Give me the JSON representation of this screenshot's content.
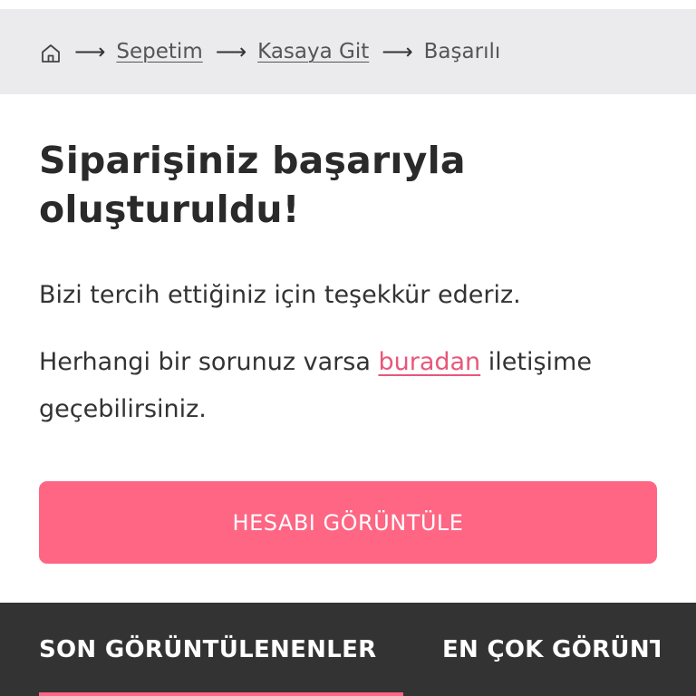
{
  "breadcrumb": {
    "home_icon": "home-icon",
    "separator": "⟶",
    "items": [
      {
        "label": "Sepetim",
        "link": true
      },
      {
        "label": "Kasaya Git",
        "link": true
      },
      {
        "label": "Başarılı",
        "link": false
      }
    ]
  },
  "main": {
    "title": "Siparişiniz başarıyla oluşturuldu!",
    "thanks_text": "Bizi tercih ettiğiniz için teşekkür ederiz.",
    "contact_prefix": "Herhangi bir sorunuz varsa ",
    "contact_link": "buradan",
    "contact_suffix": " iletişime geçebilirsiniz."
  },
  "account_button": {
    "label": "HESABI GÖRÜNTÜLE"
  },
  "bottom_tabs": [
    {
      "label": "SON GÖRÜNTÜLENENLER",
      "active": true
    },
    {
      "label": "EN ÇOK GÖRÜNTÜLENENLER",
      "active": false
    }
  ],
  "colors": {
    "accent": "#fe6684",
    "link": "#e8577a",
    "breadcrumb_bg": "#ebebee",
    "bottom_bar_bg": "#333333",
    "text": "#2a2a2a"
  }
}
